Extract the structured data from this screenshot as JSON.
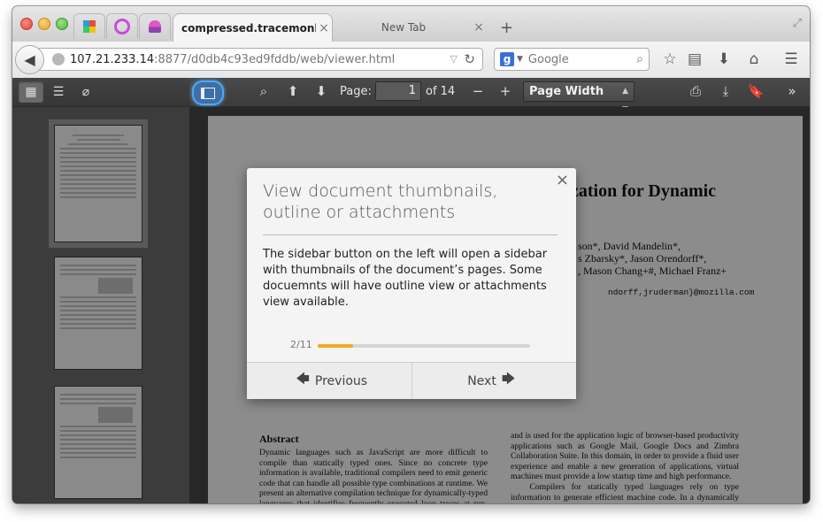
{
  "browser": {
    "tabs": [
      {
        "label": "compressed.tracemonk...",
        "active": true
      },
      {
        "label": "New Tab",
        "active": false
      }
    ],
    "tab_close": "×",
    "new_tab": "+",
    "url_host": "107.21.233.14",
    "url_rest": ":8877/d0db4c93ed9fddb/web/viewer.html",
    "search_engine_letter": "g",
    "search_placeholder": "Google",
    "icons": [
      "back-arrow",
      "globe",
      "reload",
      "star",
      "reading-list",
      "download",
      "home",
      "menu"
    ]
  },
  "pdf_toolbar": {
    "page_label": "Page:",
    "page_value": "1",
    "page_of": "of 14",
    "zoom_value": "Page Width",
    "icons": [
      "thumbnails",
      "outline",
      "attachments",
      "sidebar-toggle",
      "search",
      "previous-page",
      "next-page",
      "zoom-out",
      "zoom-in",
      "print",
      "download",
      "bookmark",
      "more-tools"
    ]
  },
  "document": {
    "title": "zation for Dynamic",
    "authors": [
      "son*, David Mandelin*,",
      "s Zbarsky*, Jason Orendorff*,",
      ", Mason Chang+#, Michael Franz+"
    ],
    "emails": "ndorff,jruderman}@mozilla.com",
    "abstract_heading": "Abstract",
    "abstract_left": "Dynamic languages such as JavaScript are more difficult to compile than statically typed ones. Since no concrete type information is available, traditional compilers need to emit generic code that can handle all possible type combinations at runtime. We present an alternative compilation technique for dynamically-typed languages that identifies frequently executed loop traces at run-time and then",
    "abstract_right": "and is used for the application logic of browser-based productivity applications such as Google Mail, Google Docs and Zimbra Collaboration Suite. In this domain, in order to provide a fluid user experience and enable a new generation of applications, virtual machines must provide a low startup time and high performance.",
    "abstract_right_2": "Compilers for statically typed languages rely on type information to generate efficient machine code. In a dynamically typed pro-"
  },
  "tour": {
    "title": "View document thumbnails, outline or attachments",
    "body": "The sidebar button on the left will open a sidebar with thumbnails of the document’s pages. Some docuemnts will have outline view or attachments view available.",
    "progress_label": "2/11",
    "progress_fraction": 0.1667,
    "previous_label": "Previous",
    "next_label": "Next",
    "close": "×"
  }
}
